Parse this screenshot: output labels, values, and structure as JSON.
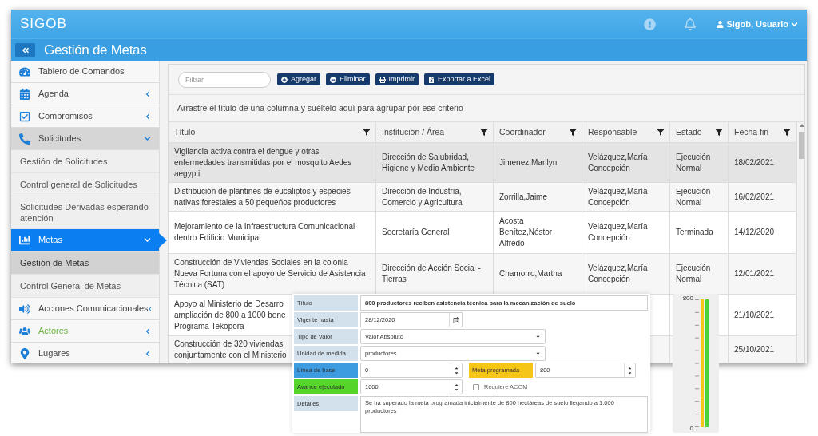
{
  "app": {
    "brand": "SIGOB",
    "user": "Sigob, Usuario",
    "page_title": "Gestión de Metas"
  },
  "sidebar": [
    {
      "label": "Tablero de Comandos",
      "selected": false,
      "highlighted": false
    },
    {
      "label": "Agenda",
      "selected": false,
      "highlighted": false,
      "expanded": false
    },
    {
      "label": "Compromisos",
      "selected": false,
      "highlighted": false,
      "expanded": false
    },
    {
      "label": "Solicitudes",
      "selected": false,
      "highlighted": false,
      "expanded": true,
      "children": [
        {
          "label": "Gestión de Solicitudes",
          "selected": false
        },
        {
          "label": "Control general de Solicitudes",
          "selected": false
        },
        {
          "label": "Solicitudes Derivadas esperando atención",
          "selected": false
        }
      ]
    },
    {
      "label": "Metas",
      "selected": true,
      "highlighted": false,
      "expanded": true,
      "children": [
        {
          "label": "Gestión de Metas",
          "selected": true
        },
        {
          "label": "Control General de Metas",
          "selected": false
        }
      ]
    },
    {
      "label": "Acciones Comunicacionales",
      "selected": false,
      "highlighted": false,
      "expanded": false
    },
    {
      "label": "Actores",
      "selected": false,
      "highlighted": true,
      "expanded": false
    },
    {
      "label": "Lugares",
      "selected": false,
      "highlighted": false,
      "expanded": false
    }
  ],
  "toolbar": {
    "filter_placeholder": "Filtrar",
    "buttons": [
      "Agregar",
      "Eliminar",
      "Imprimir",
      "Exportar a Excel"
    ]
  },
  "group_hint": "Arrastre el título de una columna y suéltelo aquí para agrupar por ese criterio",
  "table": {
    "columns": [
      "Título",
      "Institución / Área",
      "Coordinador",
      "Responsable",
      "Estado",
      "Fecha fin"
    ],
    "rows": [
      {
        "selected": true,
        "titulo": "Vigilancia activa contra el dengue y otras enfermedades transmitidas por el mosquito Aedes aegypti",
        "institucion": "Dirección de Salubridad, Higiene y Medio Ambiente",
        "coordinador": "Jimenez,Marilyn",
        "responsable": "Velázquez,María Concepción",
        "estado": "Ejecución Normal",
        "fecha_fin": "18/02/2021"
      },
      {
        "selected": false,
        "titulo": "Distribución de plantines de eucaliptos y especies nativas forestales a 50 pequeños productores",
        "institucion": "Dirección de Industria, Comercio y Agricultura",
        "coordinador": "Zorrilla,Jaime",
        "responsable": "Velázquez,María Concepción",
        "estado": "Ejecución Normal",
        "fecha_fin": "16/02/2021"
      },
      {
        "selected": false,
        "titulo": "Mejoramiento de la Infraestructura Comunicacional dentro Edificio Municipal",
        "institucion": "Secretaría General",
        "coordinador": "Acosta Benítez,Néstor Alfredo",
        "responsable": "Velázquez,María Concepción",
        "estado": "Terminada",
        "fecha_fin": "14/12/2020"
      },
      {
        "selected": false,
        "titulo": "Construcción de Viviendas Sociales en la colonia Nueva Fortuna con el apoyo de Servicio de Asistencia Técnica (SAT)",
        "institucion": "Dirección de Acción Social - Tierras",
        "coordinador": "Chamorro,Martha",
        "responsable": "Velázquez,María Concepción",
        "estado": "Ejecución Normal",
        "fecha_fin": "12/01/2021"
      },
      {
        "selected": false,
        "titulo": "Apoyo al Ministerio de Desarro\nampliación de 800 a 1000 bene\nPrograma Tekopora",
        "fecha_fin": "21/10/2021"
      },
      {
        "selected": false,
        "titulo": "Construcción de 320 viviendas\nconjuntamente con el Ministerio",
        "fecha_fin": "25/10/2021"
      }
    ]
  },
  "form": {
    "rows": [
      {
        "kind": "text",
        "label": "Título",
        "value": "800 productores reciben asistencia técnica para la mecanización de suelo"
      },
      {
        "kind": "date",
        "label": "Vigente hasta",
        "value": "28/12/2020"
      },
      {
        "kind": "select",
        "label": "Tipo de Valor",
        "value": "Valor Absoluto"
      },
      {
        "kind": "select",
        "label": "Unidad de medida",
        "value": "productores"
      },
      {
        "kind": "pair",
        "fields": [
          {
            "label": "Línea de base",
            "color": "#3d9be0",
            "value": "0"
          },
          {
            "label": "Meta programada",
            "color": "#f5c518",
            "value": "800"
          }
        ]
      },
      {
        "kind": "spin_check",
        "label": "Avance ejecutado",
        "color": "#55d42a",
        "value": "1000",
        "checkbox": {
          "label": "Requiere ACOM",
          "checked": false
        }
      },
      {
        "kind": "textarea",
        "label": "Detalles",
        "value": "Se ha superado la meta programada inicialmente de 800 hectáreas de suelo llegando a 1.000 productores"
      }
    ]
  },
  "gauge": {
    "max_label": "800",
    "min_label": "0",
    "bars": [
      {
        "color": "#f5c518",
        "level": 1
      },
      {
        "color": "#4cd137",
        "level": 1
      }
    ]
  }
}
